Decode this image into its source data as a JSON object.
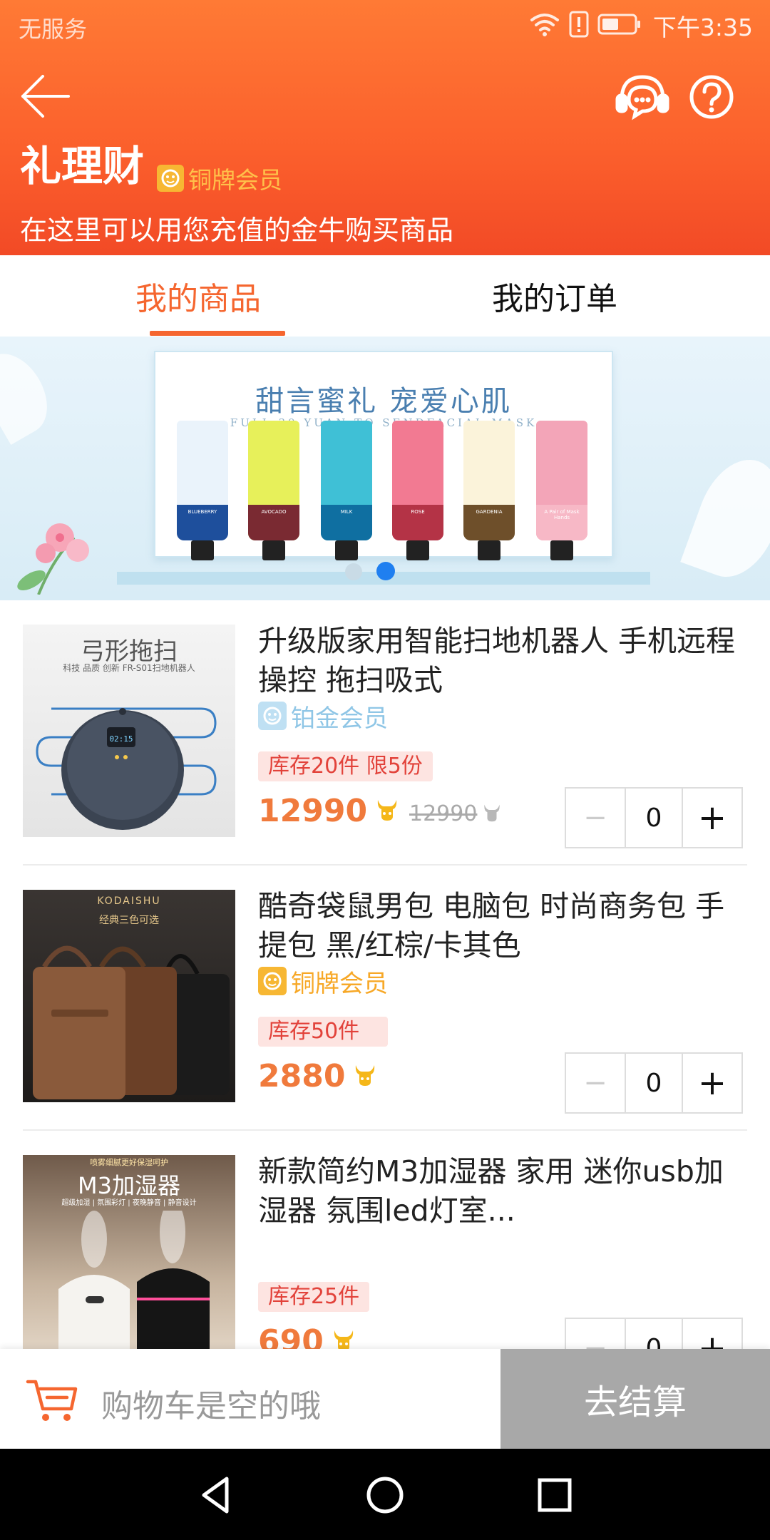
{
  "status_bar": {
    "carrier": "无服务",
    "time": "下午3:35",
    "icons": [
      "wifi-icon",
      "alert-icon",
      "battery-icon"
    ]
  },
  "header": {
    "title": "礼理财",
    "member_level": "铜牌会员",
    "subtitle": "在这里可以用您充值的金牛购买商品",
    "icons": [
      "back-arrow-icon",
      "customer-service-icon",
      "help-icon"
    ]
  },
  "tabs": {
    "goods": "我的商品",
    "orders": "我的订单",
    "active": "goods"
  },
  "banner": {
    "headline": "甜言蜜礼 宠爱心肌",
    "subline": "FULL 39 YUAN TO SENDFACIAL MASK",
    "tube_labels": [
      "BLUEBERRY",
      "AVOCADO",
      "MILK",
      "ROSE",
      "GARDENIA",
      "A Pair of Mask Hands"
    ],
    "dots": 2,
    "active_dot": 1
  },
  "products": [
    {
      "name": "升级版家用智能扫地机器人 手机远程操控 拖扫吸式",
      "level": "铂金会员",
      "level_color": "#8fc6e6",
      "stock": "库存20件 限5份",
      "price": "12990",
      "original_price": "12990",
      "quantity": "0",
      "image": {
        "heading": "弓形拖扫",
        "caption": "科技 品质 创新 FR-S01扫地机器人",
        "screen": "02:15"
      }
    },
    {
      "name": "酷奇袋鼠男包 电脑包 时尚商务包 手提包 黑/红棕/卡其色",
      "level": "铜牌会员",
      "level_color": "#f7a827",
      "stock": "库存50件",
      "price": "2880",
      "original_price": "",
      "quantity": "0",
      "image": {
        "brand": "KODAISHU",
        "caption": "经典三色可选"
      }
    },
    {
      "name": "新款简约M3加湿器 家用 迷你usb加湿器 氛围led灯室...",
      "level": "",
      "stock": "库存25件",
      "price": "690",
      "original_price": "",
      "quantity": "0",
      "image": {
        "top_text": "喷雾细腻更好保湿呵护",
        "heading": "M3加湿器",
        "caption": "超级加湿 | 氛围彩灯 | 夜晚静音 | 静音设计"
      }
    }
  ],
  "stepper": {
    "minus": "−",
    "plus": "+"
  },
  "cart": {
    "empty_text": "购物车是空的哦",
    "checkout": "去结算"
  },
  "colors": {
    "accent": "#f5662f",
    "price": "#f07a3c",
    "stock_text": "#e2423a",
    "stock_bg": "#fde4e1",
    "checkout_bg": "#a8a8a8"
  }
}
